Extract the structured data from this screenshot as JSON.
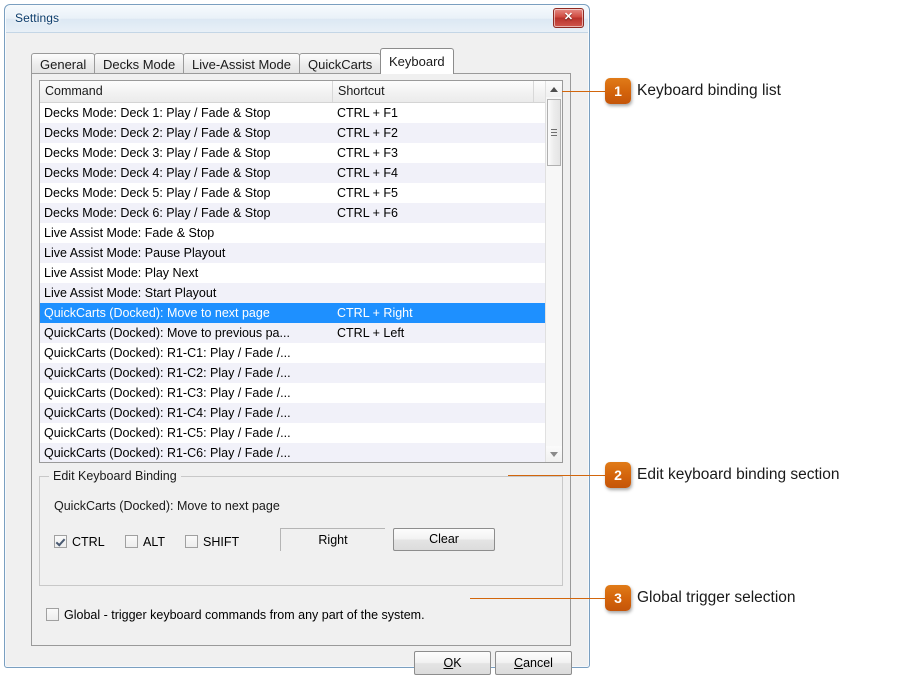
{
  "window": {
    "title": "Settings",
    "close_label": "✕"
  },
  "tabs": [
    {
      "label": "General",
      "active": false
    },
    {
      "label": "Decks Mode",
      "active": false
    },
    {
      "label": "Live-Assist Mode",
      "active": false
    },
    {
      "label": "QuickCarts",
      "active": false
    },
    {
      "label": "Keyboard",
      "active": true
    }
  ],
  "list": {
    "columns": [
      "Command",
      "Shortcut"
    ],
    "rows": [
      {
        "command": "Decks Mode: Deck 1: Play / Fade & Stop",
        "shortcut": "CTRL + F1",
        "selected": false
      },
      {
        "command": "Decks Mode: Deck 2: Play / Fade & Stop",
        "shortcut": "CTRL + F2",
        "selected": false
      },
      {
        "command": "Decks Mode: Deck 3: Play / Fade & Stop",
        "shortcut": "CTRL + F3",
        "selected": false
      },
      {
        "command": "Decks Mode: Deck 4: Play / Fade & Stop",
        "shortcut": "CTRL + F4",
        "selected": false
      },
      {
        "command": "Decks Mode: Deck 5: Play / Fade & Stop",
        "shortcut": "CTRL + F5",
        "selected": false
      },
      {
        "command": "Decks Mode: Deck 6: Play / Fade & Stop",
        "shortcut": "CTRL + F6",
        "selected": false
      },
      {
        "command": "Live Assist Mode: Fade & Stop",
        "shortcut": "",
        "selected": false
      },
      {
        "command": "Live Assist Mode: Pause Playout",
        "shortcut": "",
        "selected": false
      },
      {
        "command": "Live Assist Mode: Play Next",
        "shortcut": "",
        "selected": false
      },
      {
        "command": "Live Assist Mode: Start Playout",
        "shortcut": "",
        "selected": false
      },
      {
        "command": "QuickCarts (Docked): Move to next page",
        "shortcut": "CTRL + Right",
        "selected": true
      },
      {
        "command": "QuickCarts (Docked): Move to previous pa...",
        "shortcut": "CTRL + Left",
        "selected": false
      },
      {
        "command": "QuickCarts (Docked): R1-C1: Play / Fade /...",
        "shortcut": "",
        "selected": false
      },
      {
        "command": "QuickCarts (Docked): R1-C2: Play / Fade /...",
        "shortcut": "",
        "selected": false
      },
      {
        "command": "QuickCarts (Docked): R1-C3: Play / Fade /...",
        "shortcut": "",
        "selected": false
      },
      {
        "command": "QuickCarts (Docked): R1-C4: Play / Fade /...",
        "shortcut": "",
        "selected": false
      },
      {
        "command": "QuickCarts (Docked): R1-C5: Play / Fade /...",
        "shortcut": "",
        "selected": false
      },
      {
        "command": "QuickCarts (Docked): R1-C6: Play / Fade /...",
        "shortcut": "",
        "selected": false
      }
    ]
  },
  "edit_group": {
    "title": "Edit Keyboard Binding",
    "command": "QuickCarts (Docked): Move to next page",
    "modifiers": [
      {
        "label": "CTRL",
        "checked": true
      },
      {
        "label": "ALT",
        "checked": false
      },
      {
        "label": "SHIFT",
        "checked": false
      }
    ],
    "key_value": "Right",
    "clear_label": "Clear"
  },
  "global_option": {
    "label": "Global - trigger keyboard commands from any part of the system.",
    "checked": false
  },
  "footer": {
    "ok": {
      "accel": "O",
      "rest": "K"
    },
    "cancel": {
      "accel": "C",
      "rest": "ancel"
    }
  },
  "annotations": [
    {
      "number": "1",
      "text": "Keyboard binding list"
    },
    {
      "number": "2",
      "text": "Edit keyboard binding section"
    },
    {
      "number": "3",
      "text": "Global trigger selection"
    }
  ],
  "colors": {
    "accent_orange": "#d3630b",
    "selection_blue": "#1e90ff",
    "alt_row": "#f1f1f9",
    "title_text": "#0b3c6b"
  }
}
